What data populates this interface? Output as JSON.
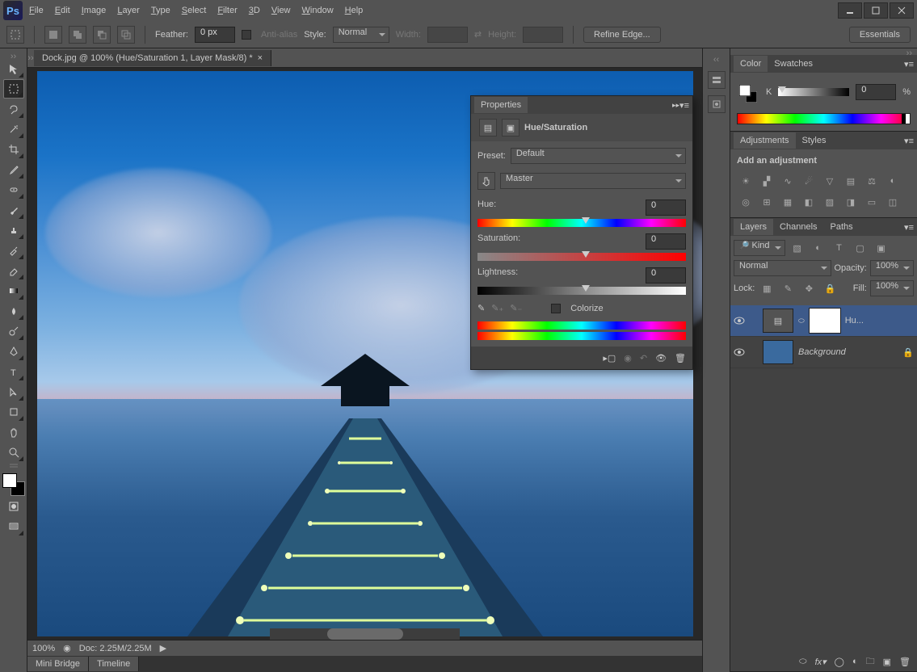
{
  "menubar": [
    "File",
    "Edit",
    "Image",
    "Layer",
    "Type",
    "Select",
    "Filter",
    "3D",
    "View",
    "Window",
    "Help"
  ],
  "optionsbar": {
    "feather_label": "Feather:",
    "feather_value": "0 px",
    "antialias": "Anti-alias",
    "style_label": "Style:",
    "style_value": "Normal",
    "width_label": "Width:",
    "height_label": "Height:",
    "refine": "Refine Edge...",
    "essentials": "Essentials"
  },
  "document": {
    "tab_title": "Dock.jpg @ 100% (Hue/Saturation 1, Layer Mask/8) *",
    "zoom": "100%",
    "doc_info": "Doc: 2.25M/2.25M"
  },
  "bottomtabs": [
    "Mini Bridge",
    "Timeline"
  ],
  "properties": {
    "title": "Properties",
    "adj_name": "Hue/Saturation",
    "preset_label": "Preset:",
    "preset_value": "Default",
    "range_value": "Master",
    "hue_label": "Hue:",
    "hue_value": "0",
    "sat_label": "Saturation:",
    "sat_value": "0",
    "light_label": "Lightness:",
    "light_value": "0",
    "colorize": "Colorize"
  },
  "color_panel": {
    "tab1": "Color",
    "tab2": "Swatches",
    "k_label": "K",
    "k_value": "0",
    "pct": "%"
  },
  "adjustments": {
    "tab1": "Adjustments",
    "tab2": "Styles",
    "heading": "Add an adjustment"
  },
  "layers": {
    "tab1": "Layers",
    "tab2": "Channels",
    "tab3": "Paths",
    "kind": "Kind",
    "blend": "Normal",
    "opacity_label": "Opacity:",
    "opacity_value": "100%",
    "lock_label": "Lock:",
    "fill_label": "Fill:",
    "fill_value": "100%",
    "layer1": "Hu...",
    "layer2": "Background"
  }
}
